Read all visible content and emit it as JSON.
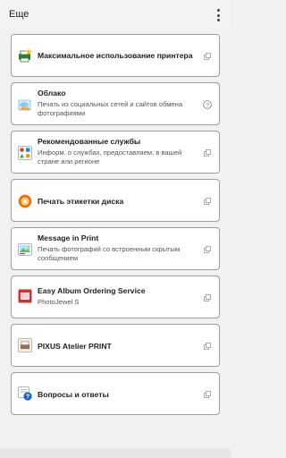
{
  "header": {
    "title": "Еще",
    "more_icon": "more-vert-icon"
  },
  "items": [
    {
      "title": "Максимальное использование принтера",
      "subtitle": "",
      "icon": "printer-star-icon",
      "action_icon": "open-external-icon"
    },
    {
      "title": "Облако",
      "subtitle": "Печать из социальных сетей и сайтов обмена фотографиями",
      "icon": "cloud-photo-icon",
      "action_icon": "help-icon"
    },
    {
      "title": "Рекомендованные службы",
      "subtitle": "Информ. о службах, предоставляем. в вашей стране или регионе",
      "icon": "services-grid-icon",
      "action_icon": "open-external-icon"
    },
    {
      "title": "Печать этикетки диска",
      "subtitle": "",
      "icon": "disc-label-icon",
      "action_icon": "open-external-icon"
    },
    {
      "title": "Message in Print",
      "subtitle": "Печать фотографий со встроенным скрытым сообщением",
      "icon": "message-in-print-icon",
      "action_icon": "open-external-icon"
    },
    {
      "title": "Easy Album Ordering Service",
      "subtitle": "PhotoJewel S",
      "icon": "photo-album-icon",
      "action_icon": "open-external-icon"
    },
    {
      "title": "PIXUS Atelier PRINT",
      "subtitle": "",
      "icon": "atelier-print-icon",
      "action_icon": "open-external-icon"
    },
    {
      "title": "Вопросы и ответы",
      "subtitle": "",
      "icon": "faq-help-icon",
      "action_icon": "open-external-icon"
    }
  ]
}
